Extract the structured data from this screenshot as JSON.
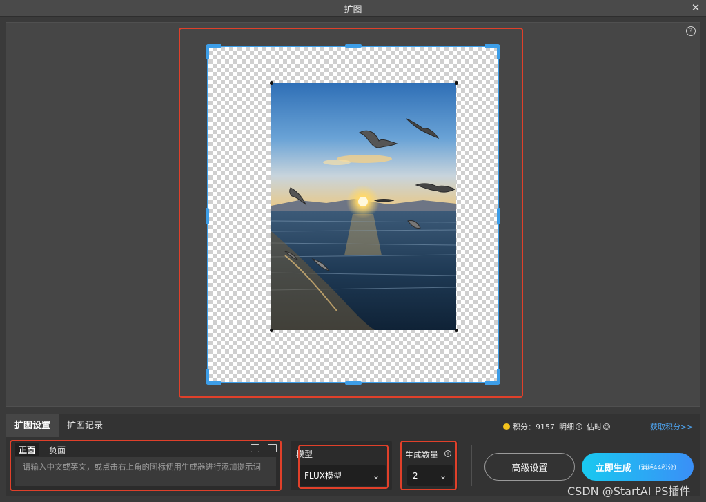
{
  "window": {
    "title": "扩图",
    "close_glyph": "✕"
  },
  "canvas": {
    "help_glyph": "?"
  },
  "panel": {
    "tabs": [
      {
        "label": "扩图设置",
        "active": true
      },
      {
        "label": "扩图记录",
        "active": false
      }
    ],
    "points": {
      "label": "积分：",
      "value": "9157",
      "detail_label": "明细",
      "estimate_label": "估时",
      "get_points_label": "获取积分>>"
    },
    "prompt": {
      "tabs": [
        {
          "label": "正面",
          "active": true
        },
        {
          "label": "负面",
          "active": false
        }
      ],
      "placeholder": "请输入中文或英文，或点击右上角的图标使用生成器进行添加提示词",
      "tool_icons": [
        "prompt-generator-icon",
        "prompt-library-icon"
      ]
    },
    "model": {
      "label": "模型",
      "value": "FLUX模型"
    },
    "count": {
      "label": "生成数量",
      "value": "2",
      "info_glyph": "!"
    },
    "buttons": {
      "advanced": "高级设置",
      "generate": "立即生成",
      "generate_cost": "（消耗44积分）"
    }
  },
  "watermark": "CSDN @StartAI PS插件",
  "colors": {
    "highlight": "#e0402a",
    "frame": "#3d9ee8",
    "accent_start": "#19c9f0",
    "accent_end": "#3a8ff7",
    "coin": "#f4c31c",
    "link": "#4ea4f0"
  }
}
